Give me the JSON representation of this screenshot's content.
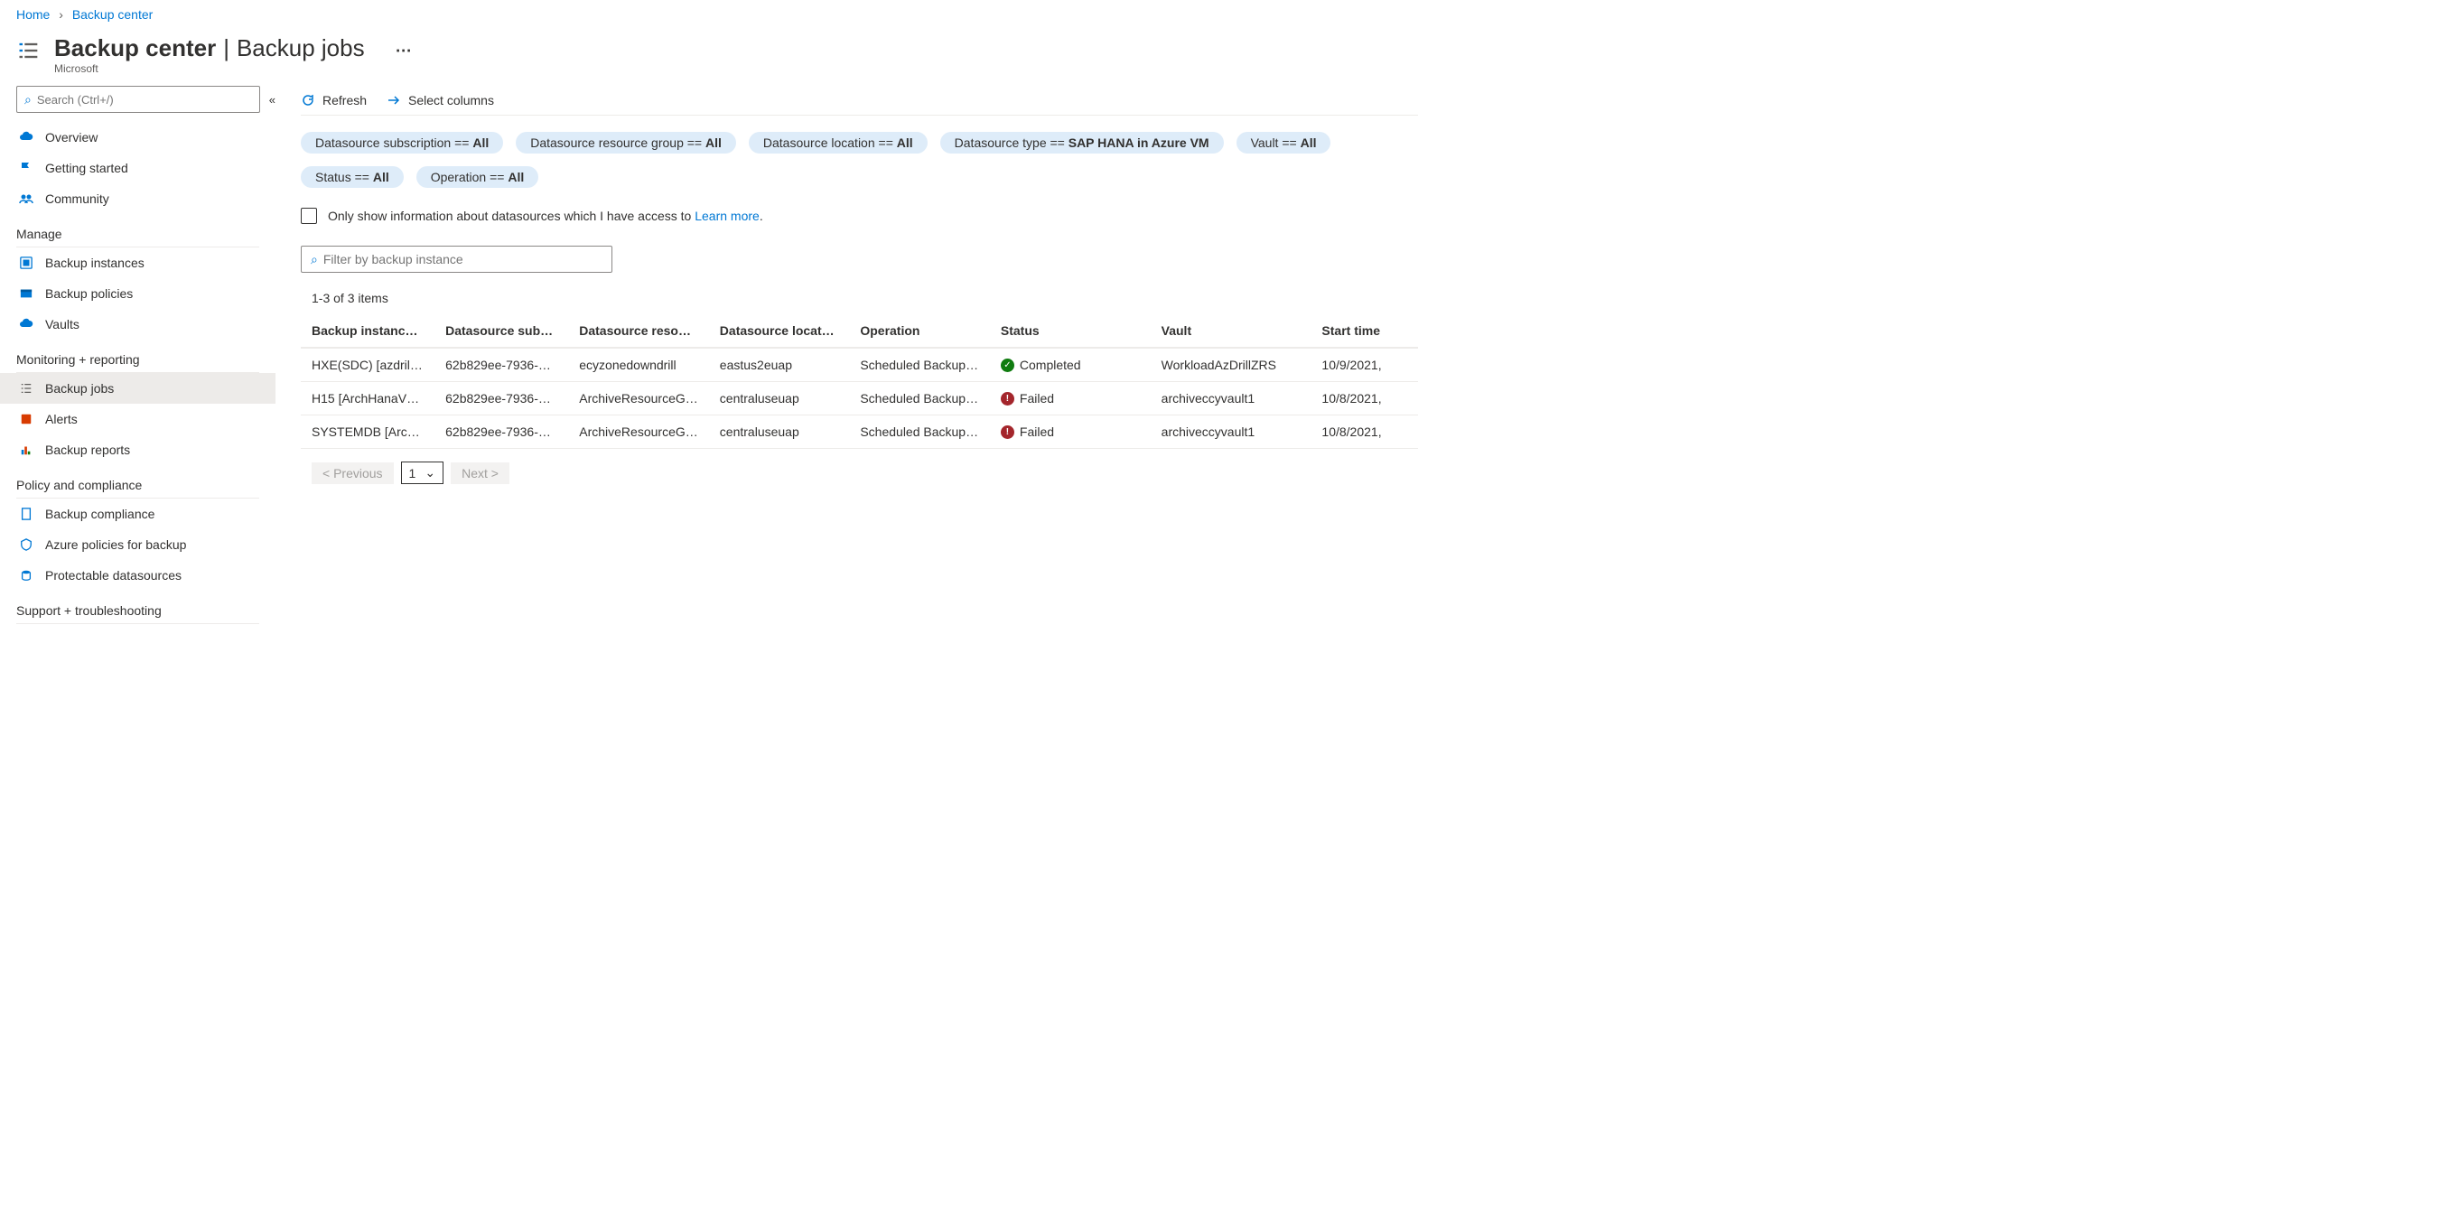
{
  "breadcrumb": {
    "home": "Home",
    "current": "Backup center"
  },
  "header": {
    "title": "Backup center",
    "subtitle": "Backup jobs",
    "org": "Microsoft",
    "more": "⋯"
  },
  "sidebar": {
    "search_placeholder": "Search (Ctrl+/)",
    "items": {
      "overview": "Overview",
      "getting_started": "Getting started",
      "community": "Community"
    },
    "section_manage": "Manage",
    "manage": {
      "backup_instances": "Backup instances",
      "backup_policies": "Backup policies",
      "vaults": "Vaults"
    },
    "section_monitoring": "Monitoring + reporting",
    "monitoring": {
      "backup_jobs": "Backup jobs",
      "alerts": "Alerts",
      "backup_reports": "Backup reports"
    },
    "section_policy": "Policy and compliance",
    "policy": {
      "backup_compliance": "Backup compliance",
      "azure_policies": "Azure policies for backup",
      "protectable": "Protectable datasources"
    },
    "section_support": "Support + troubleshooting"
  },
  "toolbar": {
    "refresh": "Refresh",
    "select_columns": "Select columns"
  },
  "filters": [
    {
      "label": "Datasource subscription == ",
      "value": "All"
    },
    {
      "label": "Datasource resource group == ",
      "value": "All"
    },
    {
      "label": "Datasource location == ",
      "value": "All"
    },
    {
      "label": "Datasource type == ",
      "value": "SAP HANA in Azure VM"
    },
    {
      "label": "Vault == ",
      "value": "All"
    },
    {
      "label": "Status == ",
      "value": "All"
    },
    {
      "label": "Operation == ",
      "value": "All"
    }
  ],
  "checkbox": {
    "label": "Only show information about datasources which I have access to ",
    "learn": "Learn more"
  },
  "filter_input_placeholder": "Filter by backup instance",
  "count": "1-3 of 3 items",
  "columns": {
    "c0": "Backup instance",
    "c1": "Datasource subs…",
    "c2": "Datasource reso…",
    "c3": "Datasource locat…",
    "c4": "Operation",
    "c5": "Status",
    "c6": "Vault",
    "c7": "Start time"
  },
  "rows": [
    {
      "bi": "HXE(SDC) [azdrillzon…",
      "sub": "62b829ee-7936-40c9…",
      "rg": "ecyzonedowndrill",
      "loc": "eastus2euap",
      "op": "Scheduled Backup (F…",
      "status": "Completed",
      "status_type": "ok",
      "vault": "WorkloadAzDrillZRS",
      "start": "10/9/2021,"
    },
    {
      "bi": "H15 [ArchHanaVM1]",
      "sub": "62b829ee-7936-40c9…",
      "rg": "ArchiveResourceGroup",
      "loc": "centraluseuap",
      "op": "Scheduled Backup (F…",
      "status": "Failed",
      "status_type": "fail",
      "vault": "archiveccyvault1",
      "start": "10/8/2021,"
    },
    {
      "bi": "SYSTEMDB [ArchHan…",
      "sub": "62b829ee-7936-40c9…",
      "rg": "ArchiveResourceGroup",
      "loc": "centraluseuap",
      "op": "Scheduled Backup (F…",
      "status": "Failed",
      "status_type": "fail",
      "vault": "archiveccyvault1",
      "start": "10/8/2021,"
    }
  ],
  "pager": {
    "prev": "< Previous",
    "page": "1",
    "next": "Next >"
  }
}
